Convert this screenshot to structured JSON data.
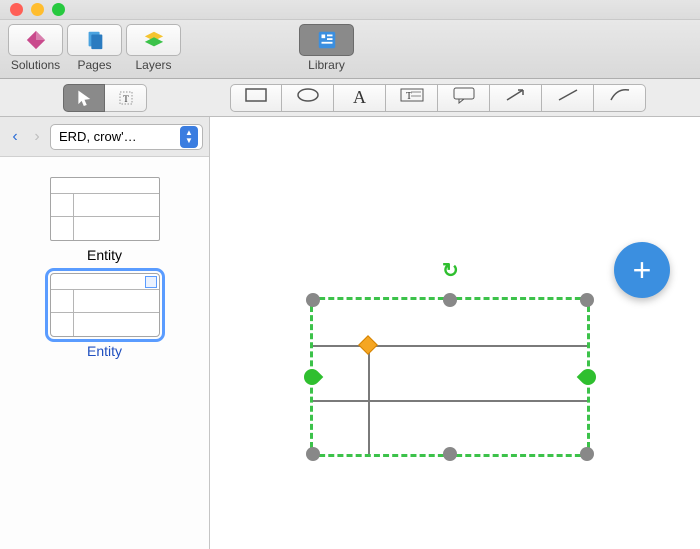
{
  "toolbar": {
    "solutions_label": "Solutions",
    "pages_label": "Pages",
    "layers_label": "Layers",
    "library_label": "Library"
  },
  "tools": {
    "pointer": "pointer",
    "text_cursor": "text-cursor",
    "shapes": [
      "rectangle",
      "ellipse",
      "text",
      "textbox",
      "callout",
      "arrow",
      "line",
      "curve"
    ]
  },
  "sidebar": {
    "back_enabled": true,
    "forward_enabled": false,
    "dropdown_label": "ERD, crow'…",
    "items": [
      {
        "label": "Entity",
        "selected": false
      },
      {
        "label": "Entity",
        "selected": true
      }
    ]
  },
  "canvas": {
    "add_button_glyph": "+",
    "selected_shape": "Entity"
  }
}
